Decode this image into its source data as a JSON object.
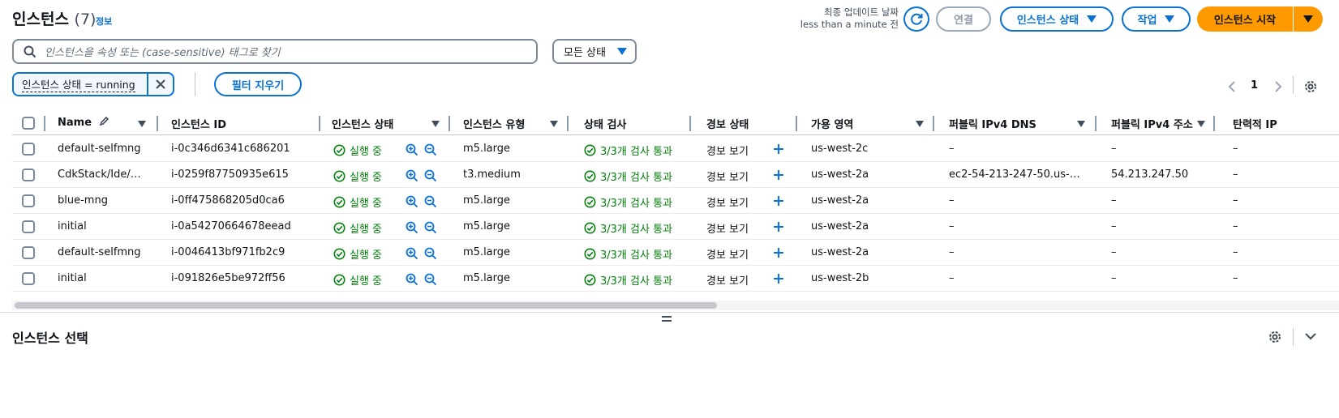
{
  "header": {
    "title": "인스턴스",
    "count": "(7)",
    "info_link": "정보",
    "updated_label": "최종 업데이트 날짜",
    "updated_value": "less than a minute 전",
    "connect_label": "연결",
    "instance_state_label": "인스턴스 상태",
    "actions_label": "작업",
    "launch_label": "인스턴스 시작"
  },
  "search": {
    "placeholder": "인스턴스을 속성 또는 (case-sensitive) 태그로 찾기"
  },
  "state_filter": {
    "selected": "모든 상태"
  },
  "filter_token": {
    "label": "인스턴스 상태 = running"
  },
  "clear_filters_label": "필터 지우기",
  "pagination": {
    "current_page": "1"
  },
  "table": {
    "columns": [
      "Name",
      "인스턴스 ID",
      "인스턴스 상태",
      "인스턴스 유형",
      "상태 검사",
      "경보 상태",
      "가용 영역",
      "퍼블릭 IPv4 DNS",
      "퍼블릭 IPv4 주소",
      "탄력적 IP"
    ],
    "rows": [
      {
        "name": "default-selfmng",
        "id": "i-0c346d6341c686201",
        "state": "실행 중",
        "type": "m5.large",
        "check": "3/3개 검사 통과",
        "alarm": "경보 보기",
        "az": "us-west-2c",
        "dns": "–",
        "ip": "–",
        "eip": "–"
      },
      {
        "name": "CdkStack/Ide/…",
        "id": "i-0259f87750935e615",
        "state": "실행 중",
        "type": "t3.medium",
        "check": "3/3개 검사 통과",
        "alarm": "경보 보기",
        "az": "us-west-2a",
        "dns": "ec2-54-213-247-50.us-…",
        "ip": "54.213.247.50",
        "eip": "–"
      },
      {
        "name": "blue-mng",
        "id": "i-0ff475868205d0ca6",
        "state": "실행 중",
        "type": "m5.large",
        "check": "3/3개 검사 통과",
        "alarm": "경보 보기",
        "az": "us-west-2a",
        "dns": "–",
        "ip": "–",
        "eip": "–"
      },
      {
        "name": "initial",
        "id": "i-0a54270664678eead",
        "state": "실행 중",
        "type": "m5.large",
        "check": "3/3개 검사 통과",
        "alarm": "경보 보기",
        "az": "us-west-2a",
        "dns": "–",
        "ip": "–",
        "eip": "–"
      },
      {
        "name": "default-selfmng",
        "id": "i-0046413bf971fb2c9",
        "state": "실행 중",
        "type": "m5.large",
        "check": "3/3개 검사 통과",
        "alarm": "경보 보기",
        "az": "us-west-2a",
        "dns": "–",
        "ip": "–",
        "eip": "–"
      },
      {
        "name": "initial",
        "id": "i-091826e5be972ff56",
        "state": "실행 중",
        "type": "m5.large",
        "check": "3/3개 검사 통과",
        "alarm": "경보 보기",
        "az": "us-west-2b",
        "dns": "–",
        "ip": "–",
        "eip": "–"
      }
    ]
  },
  "bottom_panel": {
    "title": "인스턴스 선택"
  },
  "colors": {
    "link": "#0972d3",
    "primary": "#ff9900",
    "success": "#037f0c"
  }
}
